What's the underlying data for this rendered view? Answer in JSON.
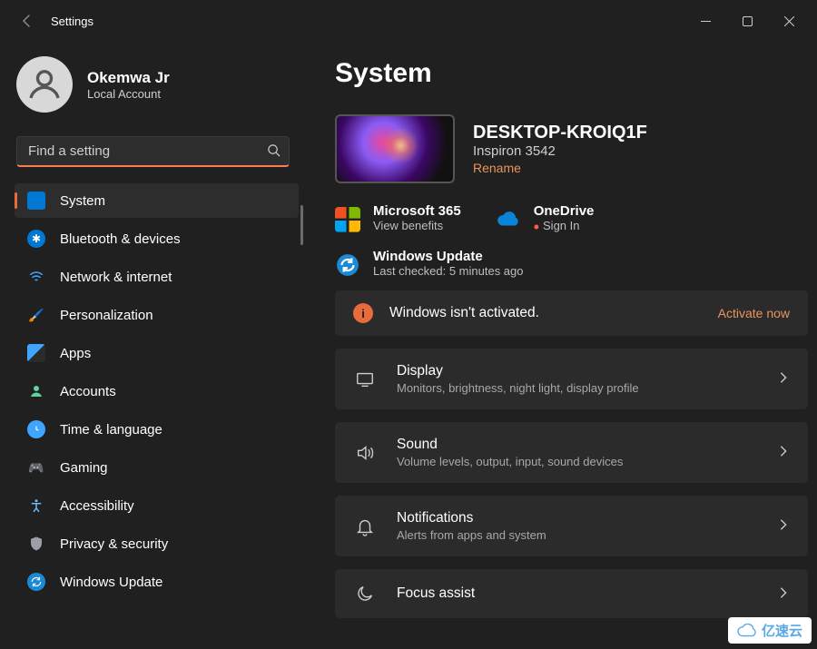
{
  "window": {
    "title": "Settings"
  },
  "profile": {
    "name": "Okemwa Jr",
    "sub": "Local Account"
  },
  "search": {
    "placeholder": "Find a setting"
  },
  "sidebar": {
    "items": [
      {
        "label": "System"
      },
      {
        "label": "Bluetooth & devices"
      },
      {
        "label": "Network & internet"
      },
      {
        "label": "Personalization"
      },
      {
        "label": "Apps"
      },
      {
        "label": "Accounts"
      },
      {
        "label": "Time & language"
      },
      {
        "label": "Gaming"
      },
      {
        "label": "Accessibility"
      },
      {
        "label": "Privacy & security"
      },
      {
        "label": "Windows Update"
      }
    ]
  },
  "page": {
    "title": "System"
  },
  "device": {
    "name": "DESKTOP-KROIQ1F",
    "model": "Inspiron 3542",
    "rename": "Rename"
  },
  "status": {
    "m365": {
      "title": "Microsoft 365",
      "sub": "View benefits"
    },
    "onedrive": {
      "title": "OneDrive",
      "sub": "Sign In"
    },
    "update": {
      "title": "Windows Update",
      "sub": "Last checked: 5 minutes ago"
    }
  },
  "activation": {
    "message": "Windows isn't activated.",
    "action": "Activate now"
  },
  "items": [
    {
      "title": "Display",
      "sub": "Monitors, brightness, night light, display profile"
    },
    {
      "title": "Sound",
      "sub": "Volume levels, output, input, sound devices"
    },
    {
      "title": "Notifications",
      "sub": "Alerts from apps and system"
    },
    {
      "title": "Focus assist",
      "sub": ""
    }
  ],
  "watermark": "亿速云"
}
